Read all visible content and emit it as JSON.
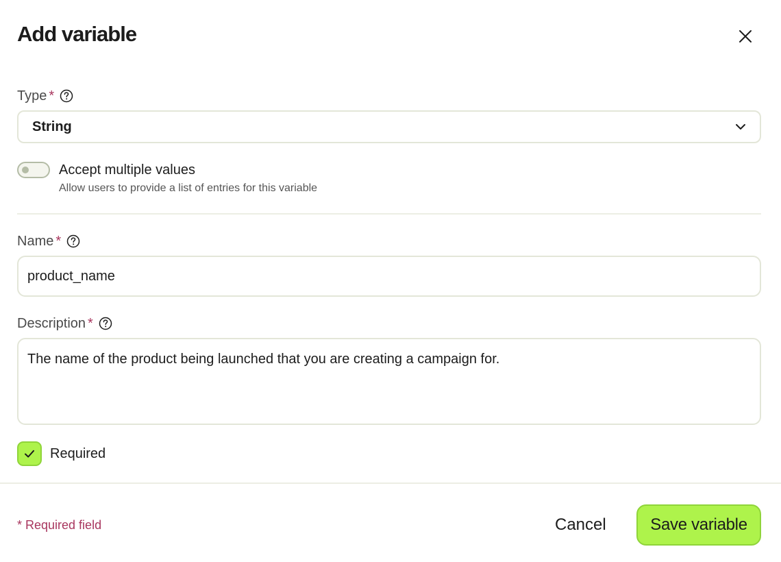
{
  "dialog": {
    "title": "Add variable"
  },
  "type_field": {
    "label": "Type",
    "required_mark": "*",
    "selected": "String"
  },
  "multiple_values": {
    "label": "Accept multiple values",
    "description": "Allow users to provide a list of entries for this variable",
    "enabled": false
  },
  "name_field": {
    "label": "Name",
    "required_mark": "*",
    "value": "product_name"
  },
  "description_field": {
    "label": "Description",
    "required_mark": "*",
    "value": "The name of the product being launched that you are creating a campaign for."
  },
  "required_checkbox": {
    "label": "Required",
    "checked": true
  },
  "footer": {
    "required_note": "* Required field",
    "cancel_label": "Cancel",
    "save_label": "Save variable"
  },
  "colors": {
    "accent": "#aef34b",
    "required_star": "#a8365e",
    "border": "#e3e6d8"
  },
  "icons": {
    "close": "close-icon",
    "help": "help-circle-icon",
    "dropdown": "chevron-down-icon",
    "check": "check-icon"
  }
}
